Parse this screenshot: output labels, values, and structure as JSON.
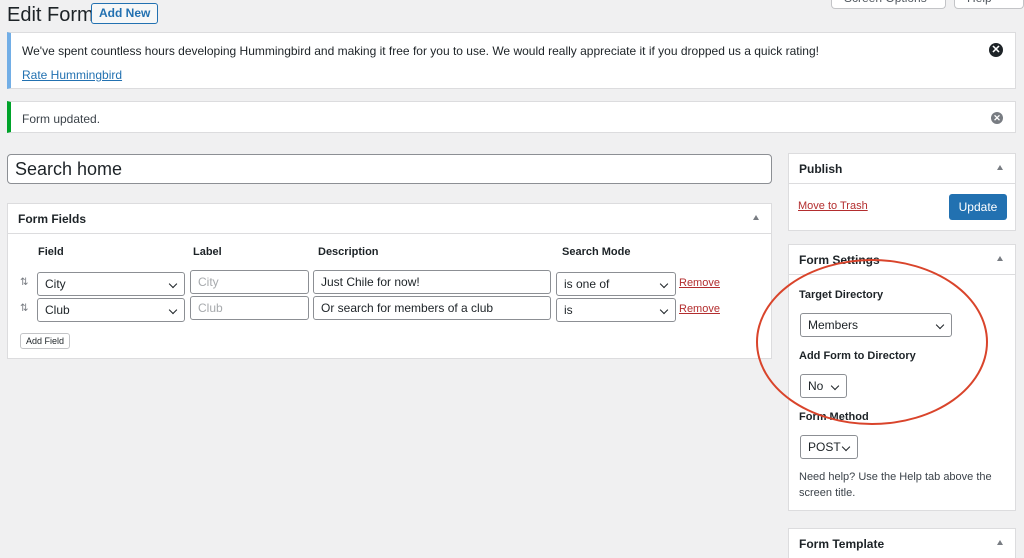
{
  "top_tabs": {
    "screen_options": "Screen Options",
    "help": "Help"
  },
  "page": {
    "title": "Edit Form",
    "add_new": "Add New"
  },
  "notices": {
    "rating": {
      "text": "We've spent countless hours developing Hummingbird and making it free for you to use. We would really appreciate it if you dropped us a quick rating!",
      "link": "Rate Hummingbird"
    },
    "updated": {
      "text": "Form updated."
    }
  },
  "form_title": "Search home",
  "form_fields": {
    "title": "Form Fields",
    "columns": [
      "Field",
      "Label",
      "Description",
      "Search Mode"
    ],
    "rows": [
      {
        "field": "City",
        "label_placeholder": "City",
        "description": "Just Chile for now!",
        "search_mode": "is one of",
        "remove": "Remove"
      },
      {
        "field": "Club",
        "label_placeholder": "Club",
        "description": "Or search for members of a club",
        "search_mode": "is",
        "remove": "Remove"
      }
    ],
    "add_field": "Add Field"
  },
  "publish": {
    "title": "Publish",
    "trash": "Move to Trash",
    "update": "Update"
  },
  "form_settings": {
    "title": "Form Settings",
    "target_directory_label": "Target Directory",
    "target_directory_value": "Members",
    "add_form_label": "Add Form to Directory",
    "add_form_value": "No",
    "method_label": "Form Method",
    "method_value": "POST",
    "help": "Need help? Use the Help tab above the screen title."
  },
  "form_template": {
    "title": "Form Template"
  },
  "colors": {
    "primary": "#2271b1",
    "danger": "#b32d2e",
    "annotation": "#d9442b",
    "info": "#72aee6",
    "success": "#00a32a"
  }
}
